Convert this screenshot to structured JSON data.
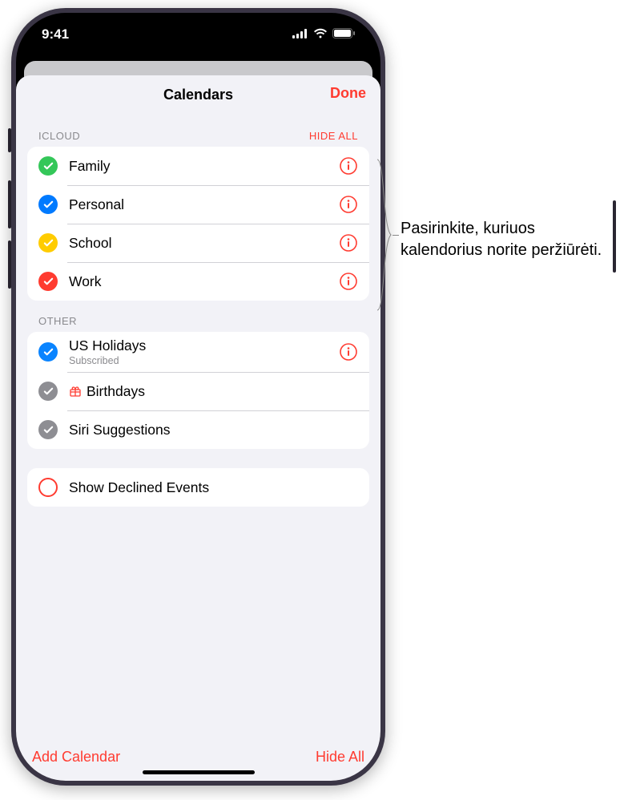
{
  "status": {
    "time": "9:41"
  },
  "header": {
    "title": "Calendars",
    "done": "Done"
  },
  "sections": {
    "icloud": {
      "label": "ICLOUD",
      "hide": "HIDE ALL",
      "items": [
        {
          "name": "Family",
          "color": "#34c759"
        },
        {
          "name": "Personal",
          "color": "#007aff"
        },
        {
          "name": "School",
          "color": "#ffcc00"
        },
        {
          "name": "Work",
          "color": "#ff3b30"
        }
      ]
    },
    "other": {
      "label": "OTHER",
      "items": [
        {
          "name": "US Holidays",
          "sub": "Subscribed",
          "color": "#0a84ff",
          "info": true
        },
        {
          "name": "Birthdays",
          "color": "#8e8e93",
          "gift": true
        },
        {
          "name": "Siri Suggestions",
          "color": "#8e8e93"
        }
      ]
    },
    "declined": {
      "label": "Show Declined Events"
    }
  },
  "toolbar": {
    "add": "Add Calendar",
    "hideAll": "Hide All"
  },
  "callout": {
    "text": "Pasirinkite, kuriuos kalendorius norite peržiūrėti."
  }
}
